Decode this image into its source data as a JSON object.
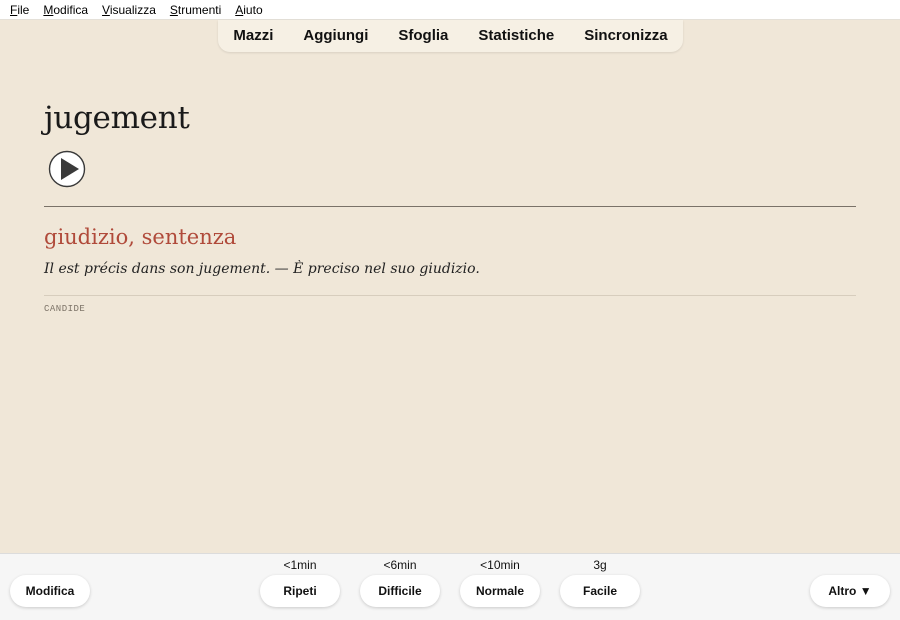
{
  "menubar": {
    "items": [
      {
        "label": "File",
        "accel": "F",
        "rest": "ile"
      },
      {
        "label": "Modifica",
        "accel": "M",
        "rest": "odifica"
      },
      {
        "label": "Visualizza",
        "accel": "V",
        "rest": "isualizza"
      },
      {
        "label": "Strumenti",
        "accel": "S",
        "rest": "trumenti"
      },
      {
        "label": "Aiuto",
        "accel": "A",
        "rest": "iuto"
      }
    ]
  },
  "nav": {
    "decks": "Mazzi",
    "add": "Aggiungi",
    "browse": "Sfoglia",
    "stats": "Statistiche",
    "sync": "Sincronizza"
  },
  "card": {
    "word": "jugement",
    "meaning": "giudizio, sentenza",
    "example": "Il est précis dans son jugement. — È preciso nel suo giudizio.",
    "deck": "CANDIDE"
  },
  "bottombar": {
    "edit": "Modifica",
    "more": "Altro ▼",
    "answers": [
      {
        "label": "Ripeti",
        "interval": "<1min"
      },
      {
        "label": "Difficile",
        "interval": "<6min"
      },
      {
        "label": "Normale",
        "interval": "<10min"
      },
      {
        "label": "Facile",
        "interval": "3g"
      }
    ]
  },
  "icons": {
    "play": "play-icon"
  }
}
